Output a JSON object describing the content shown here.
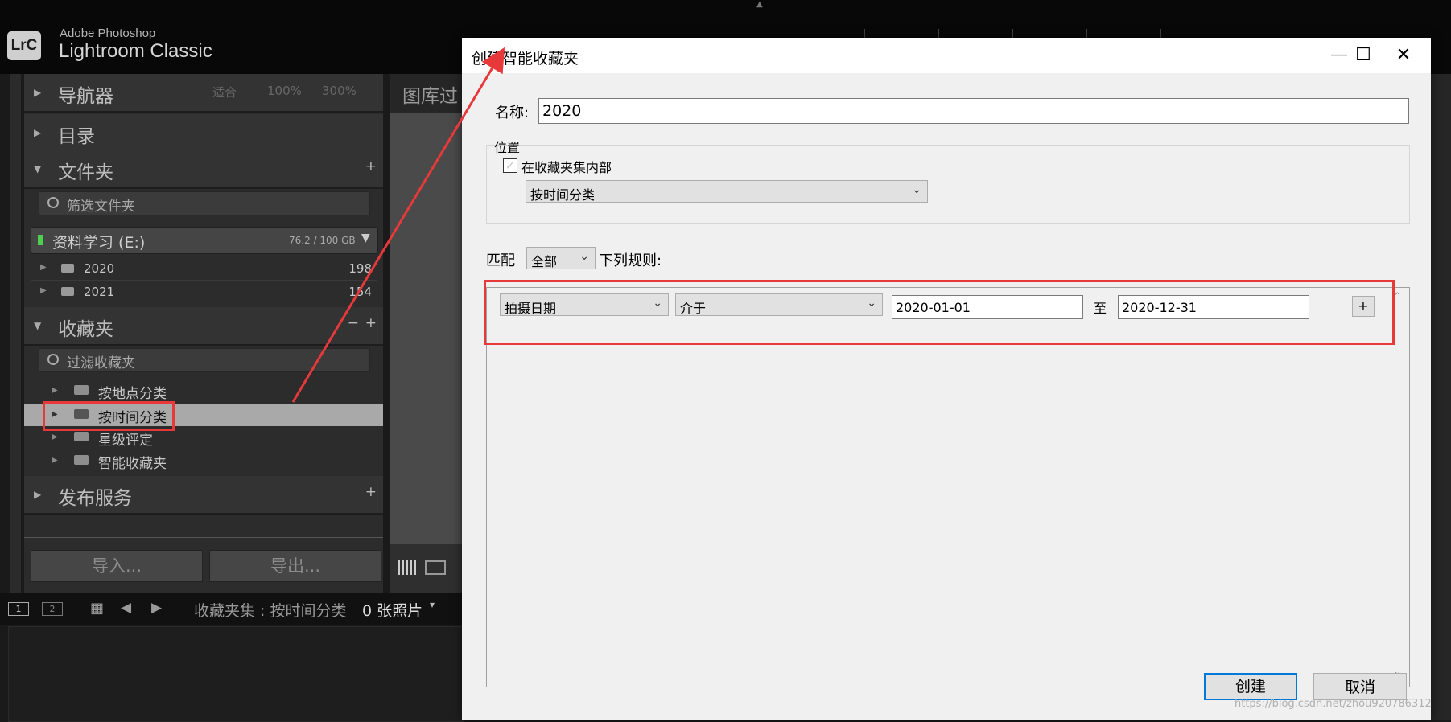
{
  "app": {
    "brand_small": "Adobe Photoshop",
    "brand_big": "Lightroom Classic",
    "logo": "LrC"
  },
  "left_panel": {
    "navigator": {
      "title": "导航器",
      "options": [
        "适合",
        "100%",
        "300%"
      ]
    },
    "catalog": {
      "title": "目录"
    },
    "folders": {
      "title": "文件夹",
      "filter_placeholder": "筛选文件夹",
      "volume": {
        "name": "资料学习 (E:)",
        "usage": "76.2 / 100 GB"
      },
      "items": [
        {
          "name": "2020",
          "count": "198"
        },
        {
          "name": "2021",
          "count": "154"
        }
      ]
    },
    "collections": {
      "title": "收藏夹",
      "filter_placeholder": "过滤收藏夹",
      "items": [
        {
          "name": "按地点分类"
        },
        {
          "name": "按时间分类"
        },
        {
          "name": "星级评定"
        },
        {
          "name": "智能收藏夹"
        }
      ]
    },
    "publish": {
      "title": "发布服务"
    },
    "import_label": "导入...",
    "export_label": "导出..."
  },
  "center": {
    "header": "图库过"
  },
  "filmstrip_bar": {
    "breadcrumb": "收藏夹集 : 按时间分类",
    "count": "0 张照片"
  },
  "dialog": {
    "title": "创建智能收藏夹",
    "name_label": "名称:",
    "name_value": "2020",
    "position_label": "位置",
    "inside_set_label": "在收藏夹集内部",
    "inside_set_checked": true,
    "set_value": "按时间分类",
    "match_label": "匹配",
    "match_value": "全部",
    "rules_label": "下列规则:",
    "rule": {
      "field": "拍摄日期",
      "operator": "介于",
      "from": "2020-01-01",
      "to_label": "至",
      "to": "2020-12-31",
      "add_label": "+"
    },
    "create_label": "创建",
    "cancel_label": "取消"
  },
  "watermark": "https://blog.csdn.net/zhou920786312",
  "colors": {
    "annotation_red": "#e8393a",
    "dialog_bg": "#f0f0f0",
    "focus_blue": "#0078d7"
  }
}
